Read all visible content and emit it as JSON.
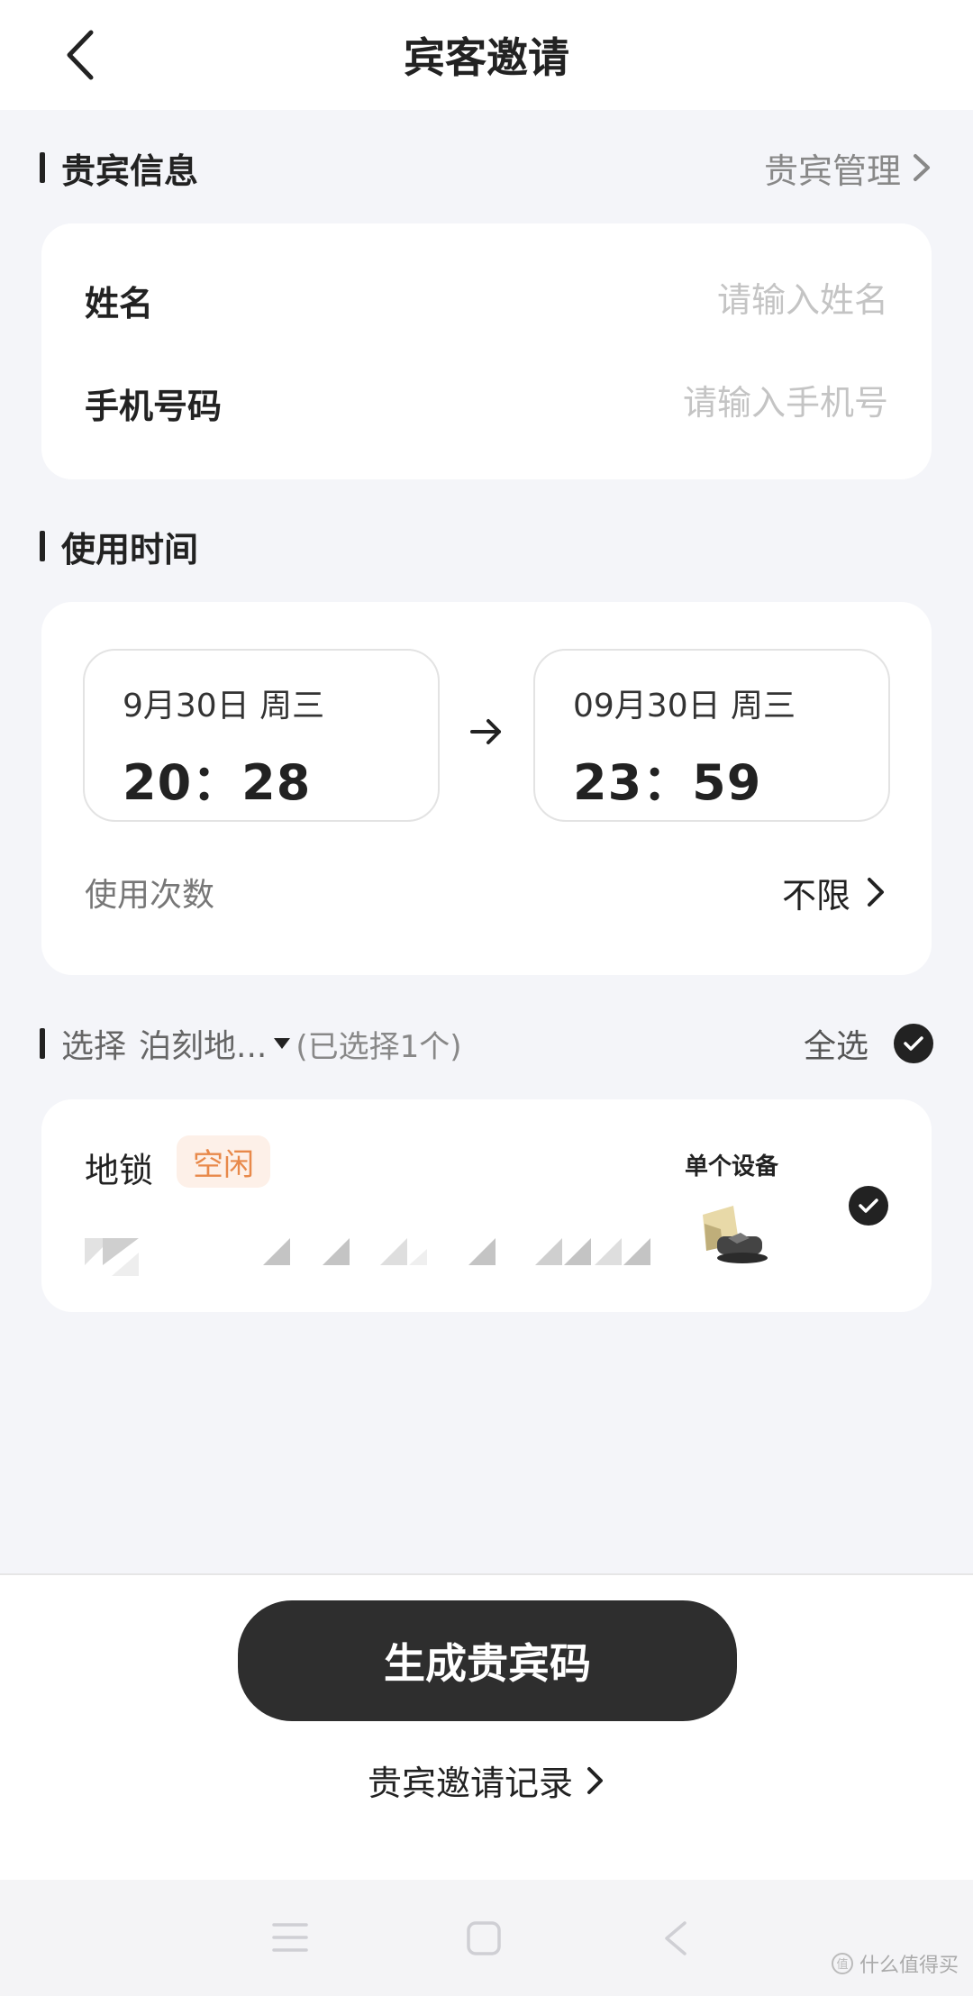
{
  "header": {
    "title": "宾客邀请",
    "back_icon": "chevron-left-icon"
  },
  "guest_info": {
    "section_title": "贵宾信息",
    "manage_link": "贵宾管理",
    "name_label": "姓名",
    "name_placeholder": "请输入姓名",
    "name_value": "",
    "phone_label": "手机号码",
    "phone_placeholder": "请输入手机号",
    "phone_value": ""
  },
  "usage_time": {
    "section_title": "使用时间",
    "start_date": "9月30日 周三",
    "start_time": "20：28",
    "end_date": "09月30日 周三",
    "end_time": "23：59",
    "count_label": "使用次数",
    "count_value": "不限"
  },
  "device_select": {
    "prefix": "选择",
    "location": "泊刻地...",
    "selected_count": "(已选择1个)",
    "select_all": "全选",
    "select_all_checked": true
  },
  "device": {
    "name": "地锁",
    "status": "空闲",
    "tag": "单个设备",
    "checked": true,
    "status_color": "#e8894a",
    "status_bg": "#fdf0e8"
  },
  "footer": {
    "primary_button": "生成贵宾码",
    "record_link": "贵宾邀请记录"
  },
  "navbar": {
    "icons": [
      "menu-icon",
      "home-square-icon",
      "back-triangle-icon"
    ]
  },
  "watermark": "什么值得买",
  "colors": {
    "background": "#f4f5f9",
    "card": "#ffffff",
    "primary": "#2e2e2e",
    "placeholder": "#c4c4c4"
  }
}
